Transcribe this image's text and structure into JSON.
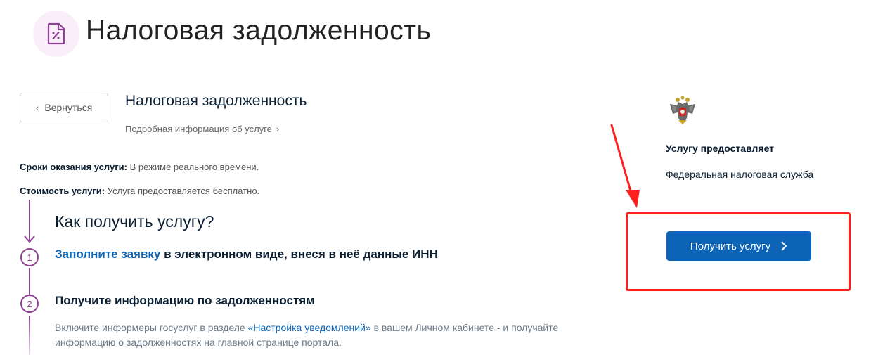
{
  "header": {
    "title": "Налоговая задолженность",
    "icon": "document-percent-icon",
    "icon_bg": "#fbeefb",
    "icon_color": "#8f4192"
  },
  "back_button": {
    "label": "Вернуться"
  },
  "service": {
    "title": "Налоговая задолженность",
    "info_link": "Подробная информация об услуге"
  },
  "meta": {
    "terms_label": "Сроки оказания услуги:",
    "terms_value": "В режиме реального времени.",
    "cost_label": "Стоимость услуги:",
    "cost_value": "Услуга предоставляется бесплатно."
  },
  "how_to": {
    "title": "Как получить услугу?",
    "steps": [
      {
        "number": "1",
        "link_text": "Заполните заявку",
        "text": "в электронном виде, внеся в неё данные ИНН"
      },
      {
        "number": "2",
        "text": "Получите информацию по задолженностям",
        "desc_before": "Включите информеры госуслуг в разделе",
        "desc_link": "«Настройка уведомлений»",
        "desc_after": "в вашем Личном кабинете - и получайте информацию о задолженностях на главной странице портала."
      }
    ]
  },
  "provider": {
    "label": "Услугу предоставляет",
    "name": "Федеральная налоговая служба",
    "emblem": "russian-coat-of-arms-icon"
  },
  "cta": {
    "label": "Получить услугу"
  },
  "colors": {
    "accent_purple": "#8f4192",
    "primary_blue": "#0d64b7",
    "highlight_red": "#ff1f1f"
  }
}
